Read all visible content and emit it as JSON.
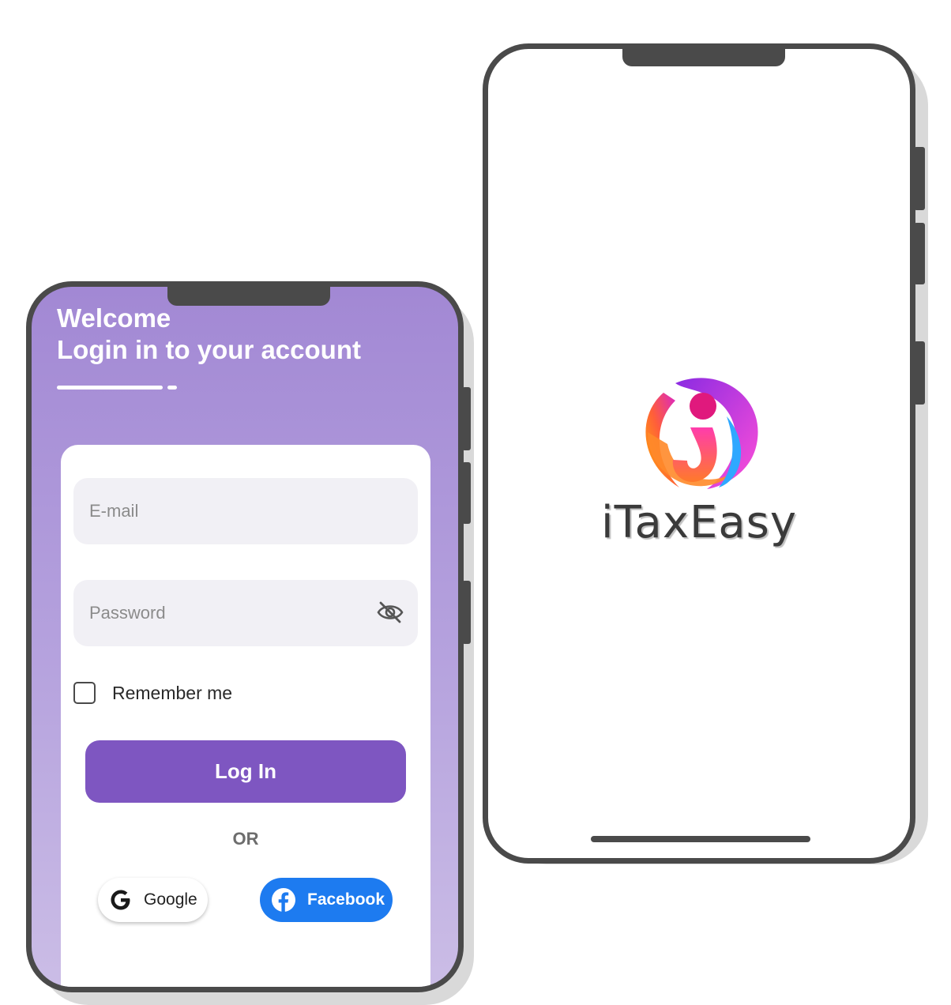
{
  "splash": {
    "brand_name": "iTaxEasy",
    "logo_icon": "itaxeasy-logo-icon"
  },
  "login": {
    "welcome_line1": "Welcome",
    "welcome_line2": "Login in to your account",
    "email": {
      "placeholder": "E-mail",
      "value": ""
    },
    "password": {
      "placeholder": "Password",
      "value": "",
      "toggle_icon": "eye-off-icon"
    },
    "remember_label": "Remember me",
    "remember_checked": false,
    "login_button": "Log In",
    "divider": "OR",
    "google_button": "Google",
    "facebook_button": "Facebook"
  },
  "colors": {
    "primary": "#7e56c1",
    "facebook": "#1d7bf0",
    "frame": "#4a4a4a",
    "field_bg": "#f1f0f5"
  }
}
